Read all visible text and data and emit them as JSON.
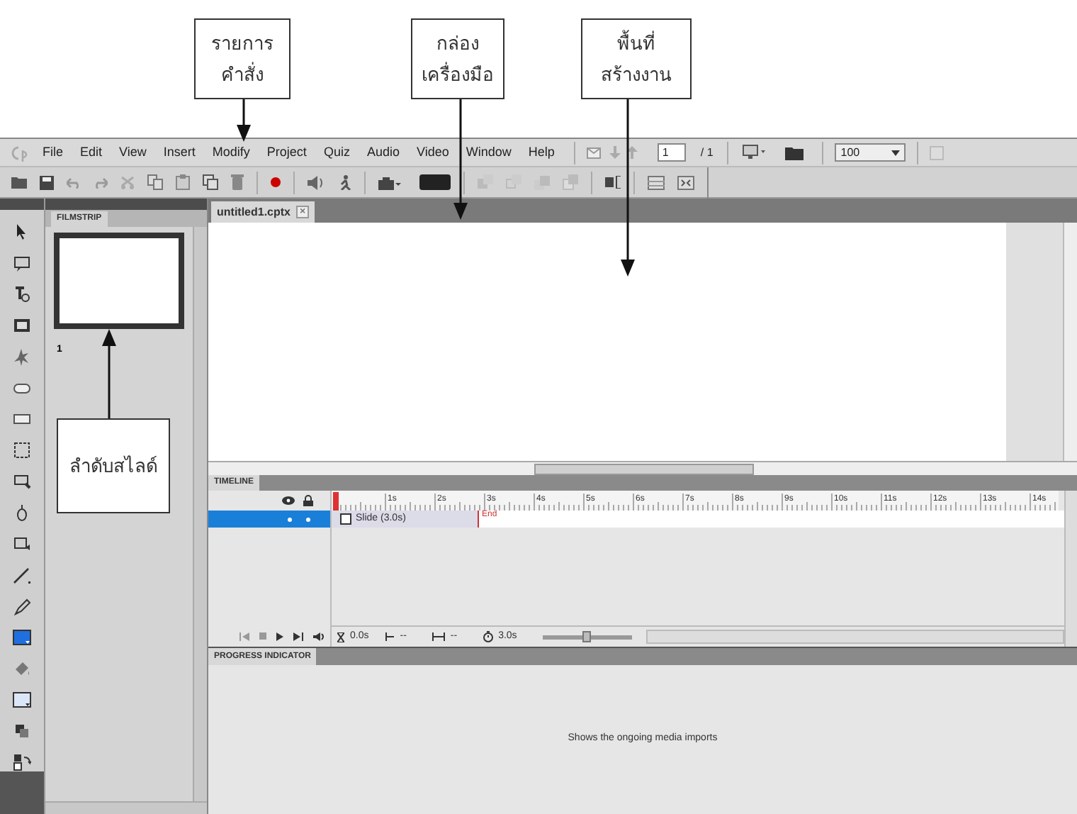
{
  "callouts": [
    {
      "lines": [
        "รายการ",
        "คำสั่ง"
      ]
    },
    {
      "lines": [
        "กล่อง",
        "เครื่องมือ"
      ]
    },
    {
      "lines": [
        "พื้นที่",
        "สร้างงาน"
      ]
    },
    {
      "lines": [
        "ลำดับสไลด์"
      ]
    }
  ],
  "menu": [
    "File",
    "Edit",
    "View",
    "Insert",
    "Modify",
    "Project",
    "Quiz",
    "Audio",
    "Video",
    "Window",
    "Help"
  ],
  "page_field": {
    "value": "1",
    "total": "/ 1"
  },
  "zoom_select": {
    "value": "100"
  },
  "document_tab": {
    "label": "untitled1.cptx",
    "close": "×"
  },
  "filmstrip": {
    "title": "FILMSTRIP",
    "slides": [
      {
        "number": "1",
        "selected": true
      }
    ]
  },
  "timeline": {
    "title": "TIMELINE",
    "ruler": [
      "1s",
      "2s",
      "3s",
      "4s",
      "5s",
      "6s",
      "7s",
      "8s",
      "9s",
      "10s",
      "11s",
      "12s",
      "13s",
      "14s"
    ],
    "layers": [
      {
        "label": "Slide (3.0s)",
        "selected": true
      }
    ],
    "end_label": "End",
    "controls": {
      "time": "0.0s",
      "start": "--",
      "duration": "--",
      "length": "3.0s"
    },
    "zoom": {
      "level": 0.5
    }
  },
  "progress": {
    "title": "PROGRESS INDICATOR",
    "message": "Shows the ongoing media imports"
  }
}
